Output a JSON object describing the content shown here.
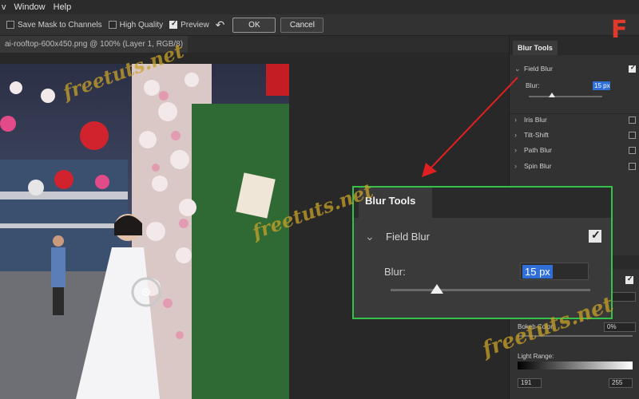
{
  "menubar": {
    "items": [
      "v",
      "Window",
      "Help"
    ]
  },
  "options": {
    "save_mask": {
      "label": "Save Mask to Channels",
      "checked": false
    },
    "high_quality": {
      "label": "High Quality",
      "checked": false
    },
    "preview": {
      "label": "Preview",
      "checked": true
    },
    "reset_icon": "undo-arrow-icon",
    "ok_label": "OK",
    "cancel_label": "Cancel"
  },
  "document": {
    "tab_title": "ai-rooftop-600x450.png @ 100% (Layer 1, RGB/8)"
  },
  "panel": {
    "tab": "Blur Tools",
    "field_blur": {
      "label": "Field Blur",
      "checked": true,
      "blur_label": "Blur:",
      "blur_value": "15 px",
      "blur_level_fraction": 0.27
    },
    "items": [
      {
        "label": "Iris Blur",
        "checked": false
      },
      {
        "label": "Tilt-Shift",
        "checked": false
      },
      {
        "label": "Path Blur",
        "checked": false
      },
      {
        "label": "Spin Blur",
        "checked": false
      }
    ],
    "bokeh_color_label": "Bokeh Color:",
    "bokeh_color_value": "0%",
    "light_range_label": "Light Range:",
    "light_range_min": "191",
    "light_range_max": "255"
  },
  "callout": {
    "tab": "Blur Tools",
    "field_label": "Field Blur",
    "blur_label": "Blur:",
    "blur_value": "15 px",
    "border_color": "#35c24a"
  },
  "watermark": "freetuts.net",
  "logo": "F",
  "colors": {
    "arrow": "#e02020",
    "selection": "#2f6fd6",
    "callout_border": "#35c24a"
  }
}
